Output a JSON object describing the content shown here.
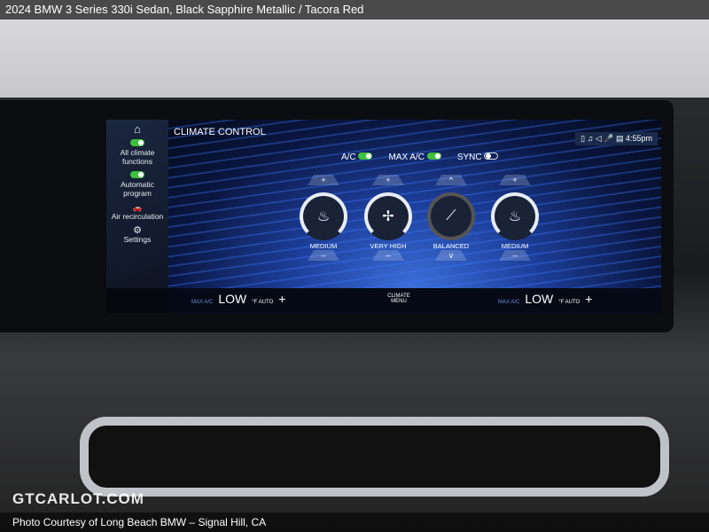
{
  "header": {
    "title": "2024 BMW 3 Series 330i Sedan,  Black Sapphire Metallic / Tacora Red"
  },
  "screen": {
    "title": "CLIMATE CONTROL",
    "sidebar": [
      {
        "icon": "home-icon",
        "label": ""
      },
      {
        "icon": "toggle-on",
        "label": "All climate functions"
      },
      {
        "icon": "toggle-on",
        "label": "Automatic program"
      },
      {
        "icon": "car-recirculation-icon",
        "label": "Air recirculation"
      },
      {
        "icon": "gear-icon",
        "label": "Settings"
      }
    ],
    "toggles": [
      {
        "label": "A/C",
        "on": true
      },
      {
        "label": "MAX A/C",
        "on": true
      },
      {
        "label": "SYNC",
        "on": false
      }
    ],
    "status": {
      "time": "4:55pm"
    },
    "dials": [
      {
        "label": "MEDIUM",
        "up": "+",
        "down": "–",
        "icon": "seat-heat-icon"
      },
      {
        "label": "VERY HIGH",
        "up": "+",
        "down": "–",
        "icon": "fan-icon"
      },
      {
        "label": "BALANCED",
        "up": "^",
        "down": "v",
        "icon": "seat-airflow-icon"
      },
      {
        "label": "MEDIUM",
        "up": "+",
        "down": "–",
        "icon": "seat-heat-icon"
      }
    ],
    "left_zone": {
      "max": "MAX A/C",
      "temp": "LOW",
      "unit": "°F AUTO",
      "plus": "+"
    },
    "right_zone": {
      "max": "MAX A/C",
      "temp": "LOW",
      "unit": "°F AUTO",
      "plus": "+"
    },
    "climate_menu": "CLIMATE MENU"
  },
  "watermark": "GTCARLOT.COM",
  "footer": "Photo Courtesy of Long Beach BMW – Signal Hill, CA",
  "colors": {
    "toggle": "#3fbf3f",
    "accent": "#2f6fe0"
  }
}
